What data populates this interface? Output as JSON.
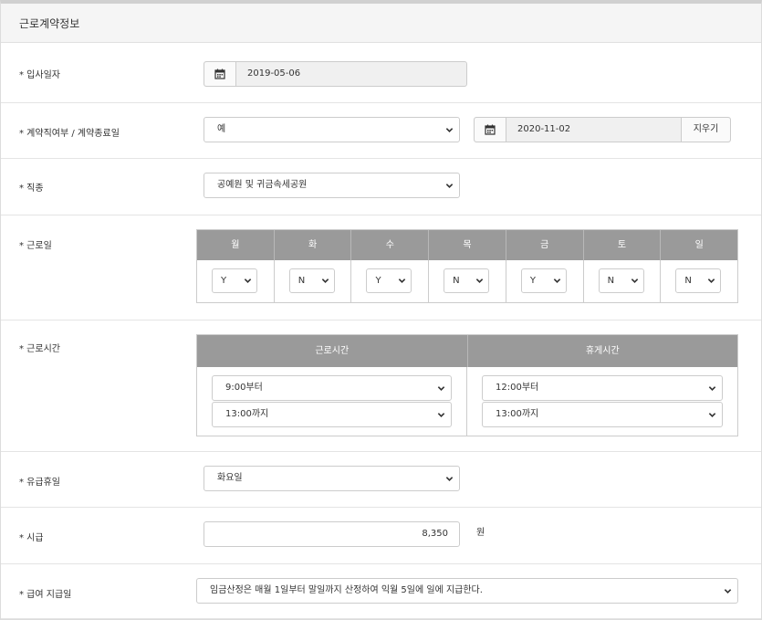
{
  "panel": {
    "title": "근로계약정보"
  },
  "fields": {
    "hire_date": {
      "label": "* 입사일자",
      "value": "2019-05-06"
    },
    "contract": {
      "label": "* 계약직여부 / 계약종료일",
      "type_value": "예",
      "end_date": "2020-11-02",
      "clear_label": "지우기"
    },
    "job_type": {
      "label": "* 직종",
      "value": "공예원 및 귀금속세공원"
    },
    "work_days": {
      "label": "* 근로일",
      "days": [
        {
          "name": "월",
          "value": "Y"
        },
        {
          "name": "화",
          "value": "N"
        },
        {
          "name": "수",
          "value": "Y"
        },
        {
          "name": "목",
          "value": "N"
        },
        {
          "name": "금",
          "value": "Y"
        },
        {
          "name": "토",
          "value": "N"
        },
        {
          "name": "일",
          "value": "N"
        }
      ]
    },
    "work_time": {
      "label": "* 근로시간",
      "work_header": "근로시간",
      "break_header": "휴게시간",
      "work_start": "9:00부터",
      "work_end": "13:00까지",
      "break_start": "12:00부터",
      "break_end": "13:00까지"
    },
    "paid_holiday": {
      "label": "* 유급휴일",
      "value": "화요일"
    },
    "hourly_wage": {
      "label": "* 시급",
      "value": "8,350",
      "unit": "원"
    },
    "pay_day": {
      "label": "* 급여 지급일",
      "value": "임금산정은 매월 1일부터 말일까지 산정하여 익월 5일에 일에 지급한다."
    }
  },
  "icons": {
    "calendar": "calendar-icon",
    "chevron": "chevron-down-icon"
  }
}
